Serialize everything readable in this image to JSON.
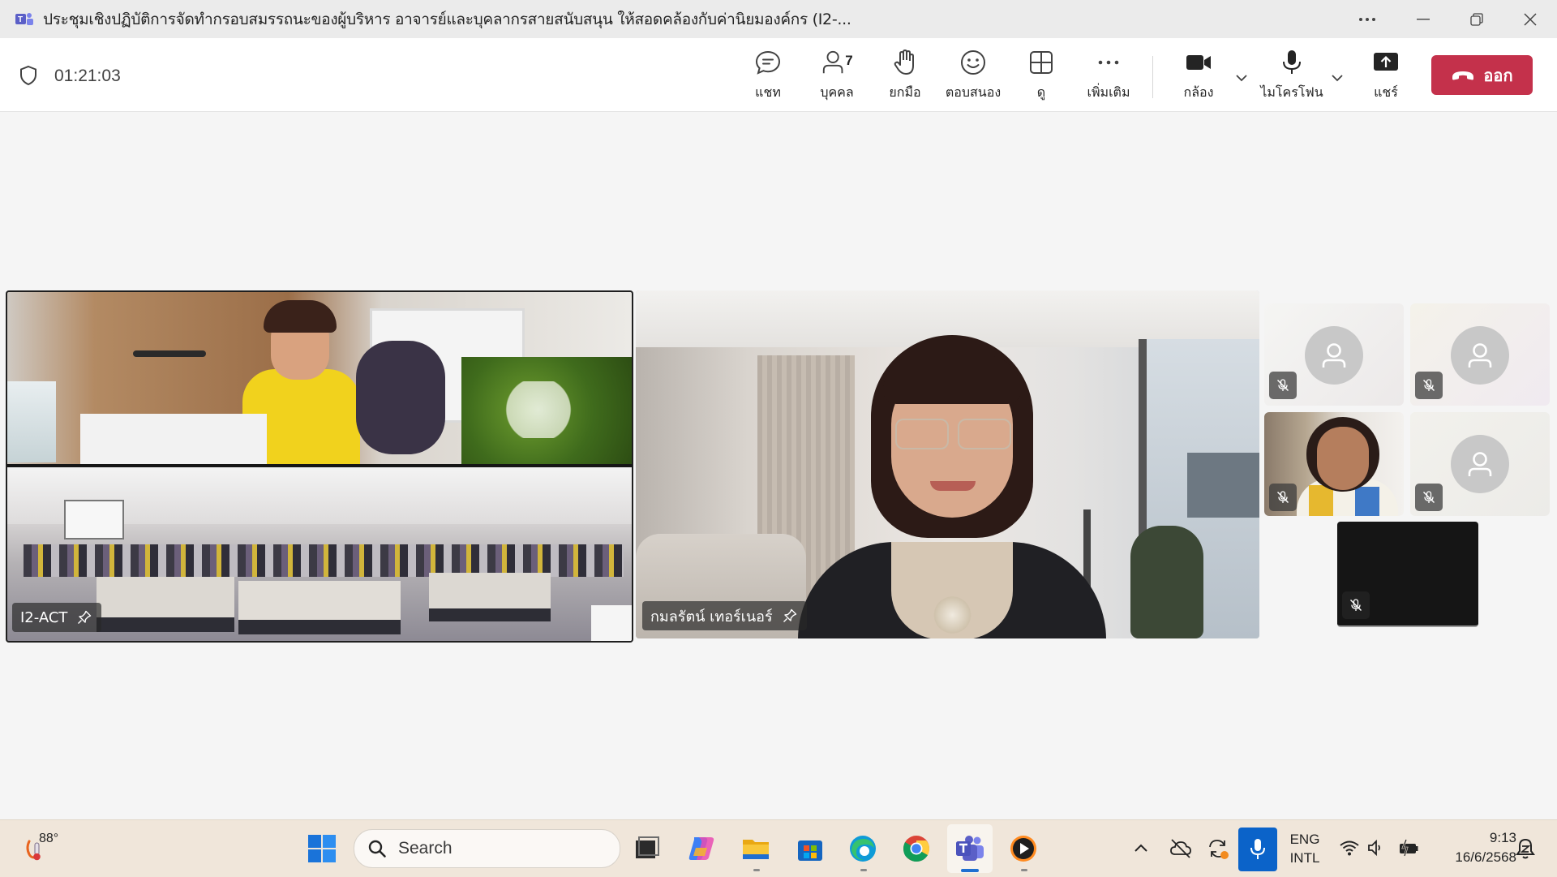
{
  "window": {
    "title": "ประชุมเชิงปฏิบัติการจัดทำกรอบสมรรถนะของผู้บริหาร อาจารย์และบุคลากรสายสนับสนุน ให้สอดคล้องกับค่านิยมองค์กร (I2-...",
    "more_icon": "more-horizontal-icon",
    "minimize_icon": "minimize-icon",
    "restore_icon": "restore-icon",
    "close_icon": "close-icon"
  },
  "meeting": {
    "timer": "01:21:03",
    "participant_count": "7"
  },
  "toolbar": {
    "chat_label": "แชท",
    "people_label": "บุคคล",
    "raise_label": "ยกมือ",
    "react_label": "ตอบสนอง",
    "view_label": "ดู",
    "more_label": "เพิ่มเติม",
    "camera_label": "กล้อง",
    "mic_label": "ไมโครโฟน",
    "share_label": "แชร์",
    "leave_label": "ออก"
  },
  "stage": {
    "tile_1_name": "I2-ACT",
    "tile_2_name": "กมลรัตน์ เทอร์เนอร์"
  },
  "taskbar": {
    "weather_temp": "88°",
    "search_placeholder": "Search",
    "lang_top": "ENG",
    "lang_bottom": "INTL",
    "time": "9:13",
    "date": "16/6/2568"
  },
  "colors": {
    "leave_button": "#c4314b",
    "teams_brand": "#5b5fc7"
  }
}
